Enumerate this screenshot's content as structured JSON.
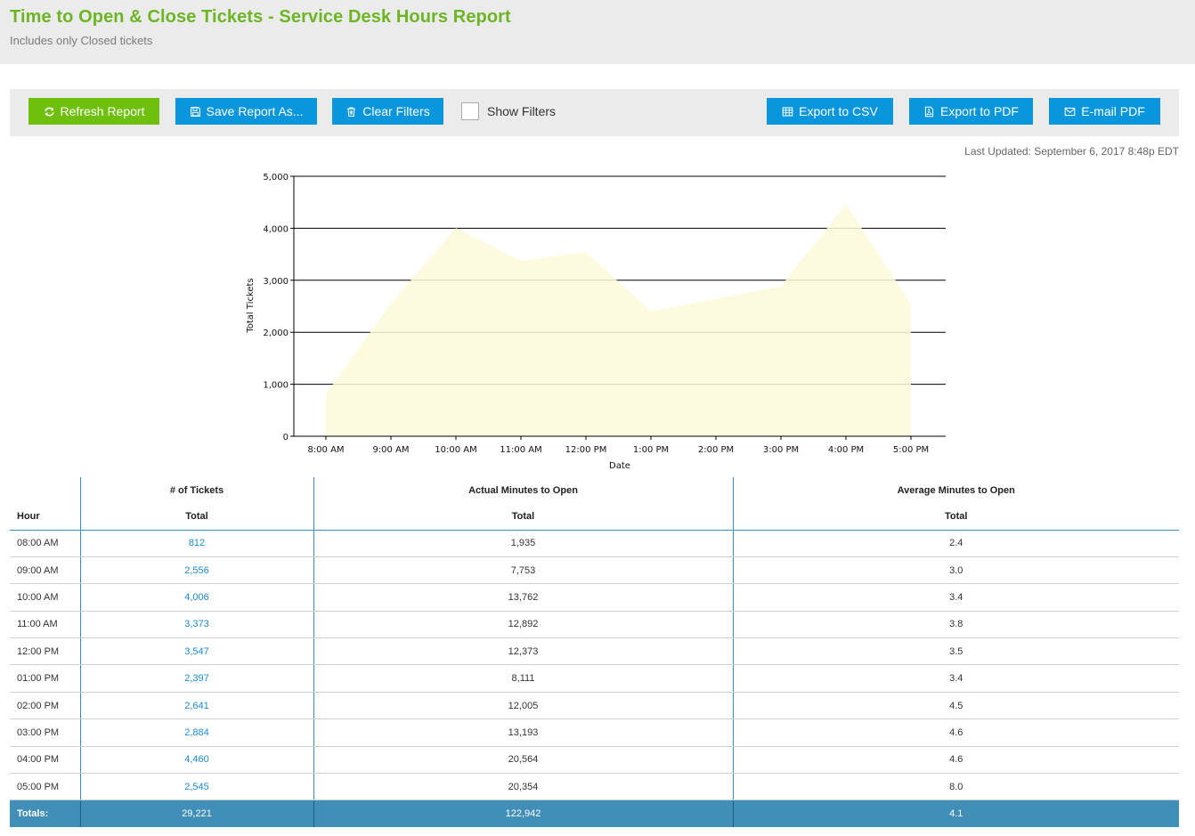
{
  "header": {
    "title": "Time to Open & Close Tickets - Service Desk Hours Report",
    "subtitle": "Includes only Closed tickets"
  },
  "toolbar": {
    "refresh_label": "Refresh Report",
    "save_label": "Save Report As...",
    "clear_label": "Clear Filters",
    "show_filters_label": "Show Filters",
    "show_filters_checked": false,
    "export_csv_label": "Export to CSV",
    "export_pdf_label": "Export to PDF",
    "email_pdf_label": "E-mail PDF",
    "colors": {
      "primary": "#0a96dc",
      "refresh": "#6fbf0e"
    }
  },
  "last_updated": "Last Updated: September 6, 2017 8:48p EDT",
  "chart_data": {
    "type": "area",
    "title": "",
    "xlabel": "Date",
    "ylabel": "Total Tickets",
    "categories": [
      "8:00 AM",
      "9:00 AM",
      "10:00 AM",
      "11:00 AM",
      "12:00 PM",
      "1:00 PM",
      "2:00 PM",
      "3:00 PM",
      "4:00 PM",
      "5:00 PM"
    ],
    "series": [
      {
        "name": "Total Tickets",
        "values": [
          812,
          2556,
          4006,
          3373,
          3547,
          2397,
          2641,
          2884,
          4460,
          2545
        ],
        "color": "#fdfad9"
      }
    ],
    "ylim": [
      0,
      5000
    ],
    "yticks": [
      0,
      1000,
      2000,
      3000,
      4000,
      5000
    ],
    "ytick_labels": [
      "0",
      "1,000",
      "2,000",
      "3,000",
      "4,000",
      "5,000"
    ],
    "grid": true,
    "legend": "none"
  },
  "table": {
    "group_headers": [
      "",
      "# of Tickets",
      "Actual Minutes to Open",
      "Average Minutes to Open"
    ],
    "sub_headers": [
      "Hour",
      "Total",
      "Total",
      "Total"
    ],
    "rows": [
      [
        "08:00 AM",
        "812",
        "1,935",
        "2.4"
      ],
      [
        "09:00 AM",
        "2,556",
        "7,753",
        "3.0"
      ],
      [
        "10:00 AM",
        "4,006",
        "13,762",
        "3.4"
      ],
      [
        "11:00 AM",
        "3,373",
        "12,892",
        "3.8"
      ],
      [
        "12:00 PM",
        "3,547",
        "12,373",
        "3.5"
      ],
      [
        "01:00 PM",
        "2,397",
        "8,111",
        "3.4"
      ],
      [
        "02:00 PM",
        "2,641",
        "12,005",
        "4.5"
      ],
      [
        "03:00 PM",
        "2,884",
        "13,193",
        "4.6"
      ],
      [
        "04:00 PM",
        "4,460",
        "20,564",
        "4.6"
      ],
      [
        "05:00 PM",
        "2,545",
        "20,354",
        "8.0"
      ]
    ],
    "totals": [
      "Totals:",
      "29,221",
      "122,942",
      "4.1"
    ]
  }
}
